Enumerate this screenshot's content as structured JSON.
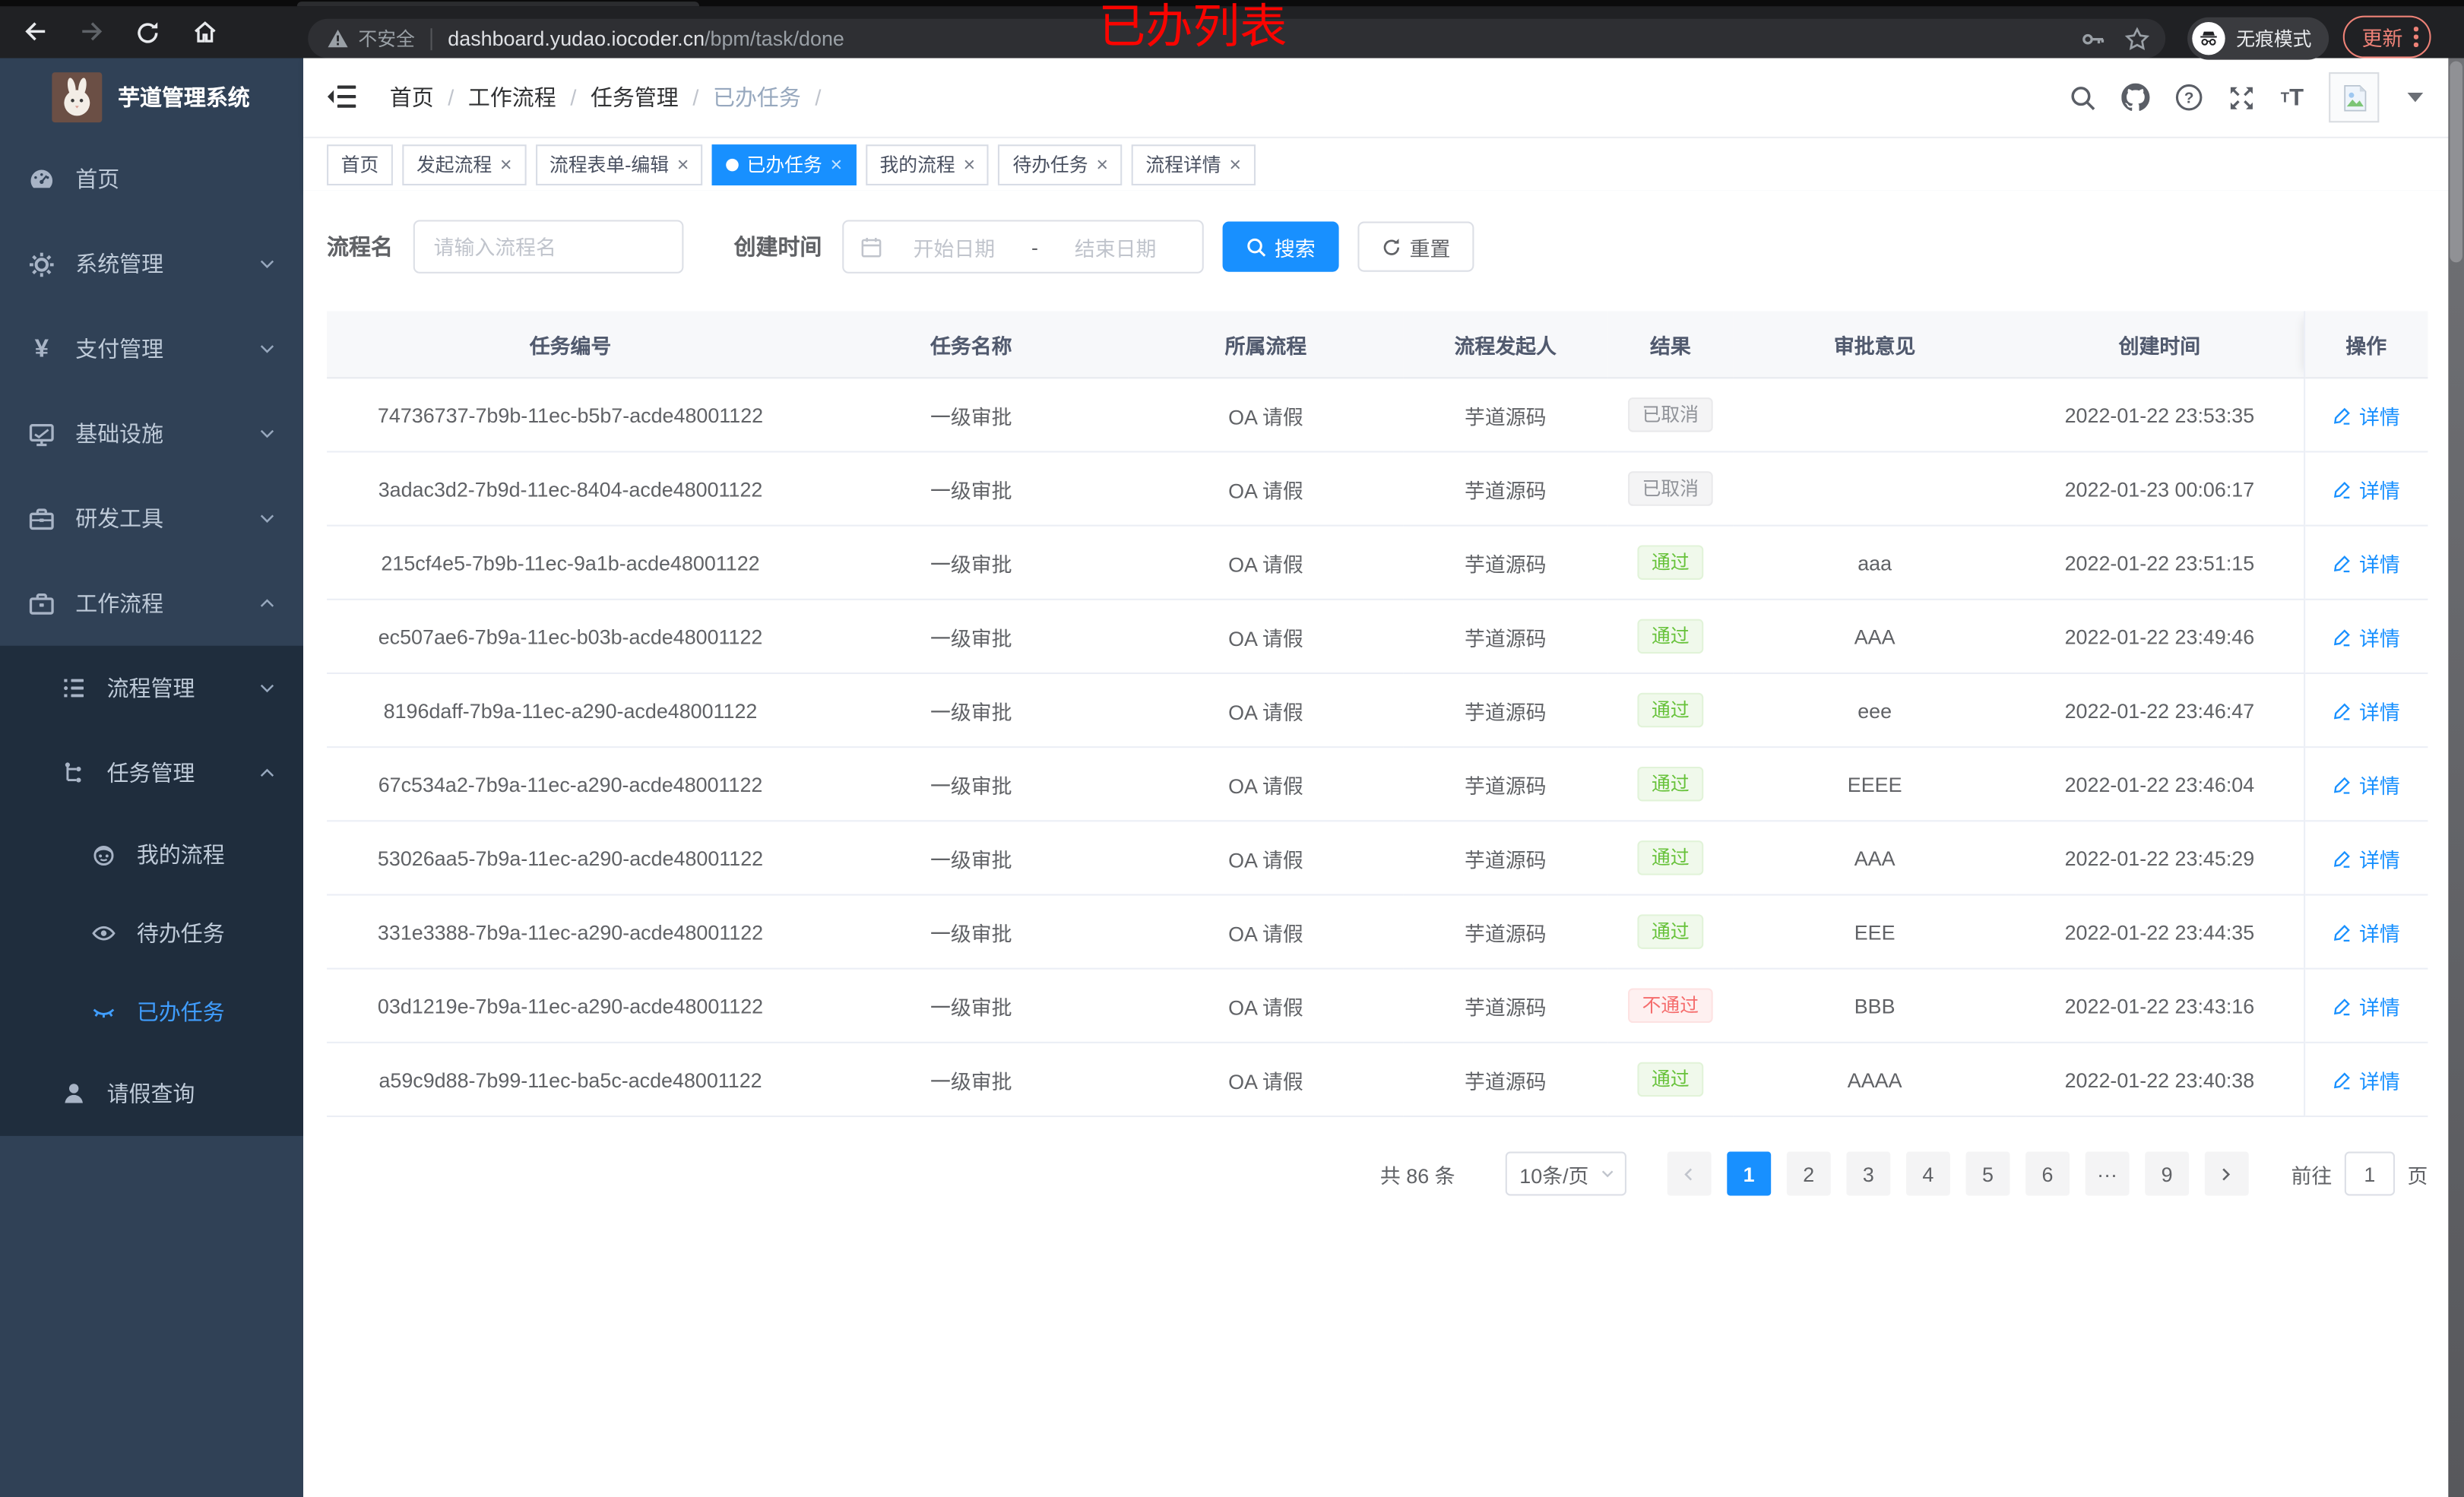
{
  "annotation": {
    "text": "已办列表",
    "color": "#fa0400"
  },
  "browser": {
    "security_label": "不安全",
    "url_host": "dashboard.yudao.iocoder.cn",
    "url_path": "/bpm/task/done",
    "incognito_label": "无痕模式",
    "update_label": "更新",
    "nav_icons": [
      "back-icon",
      "forward-icon",
      "reload-icon",
      "home-icon"
    ],
    "omnibox_icons": [
      "warning-icon",
      "key-icon",
      "star-icon"
    ],
    "right_icons": [
      "incognito-icon",
      "more-vert-icon"
    ]
  },
  "sidebar": {
    "logo_title": "芋道管理系统",
    "items": [
      {
        "label": "首页",
        "icon": "dashboard-icon",
        "level": 1
      },
      {
        "label": "系统管理",
        "icon": "gear-icon",
        "level": 1,
        "chevron": "down"
      },
      {
        "label": "支付管理",
        "icon": "yen-icon",
        "level": 1,
        "chevron": "down"
      },
      {
        "label": "基础设施",
        "icon": "monitor-icon",
        "level": 1,
        "chevron": "down"
      },
      {
        "label": "研发工具",
        "icon": "toolbox-icon",
        "level": 1,
        "chevron": "down"
      },
      {
        "label": "工作流程",
        "icon": "briefcase-icon",
        "level": 1,
        "chevron": "up"
      },
      {
        "label": "流程管理",
        "icon": "list-tree-icon",
        "level": 2,
        "chevron": "down"
      },
      {
        "label": "任务管理",
        "icon": "org-tree-icon",
        "level": 2,
        "chevron": "up"
      },
      {
        "label": "我的流程",
        "icon": "robot-icon",
        "level": 3
      },
      {
        "label": "待办任务",
        "icon": "eye-icon",
        "level": 3
      },
      {
        "label": "已办任务",
        "icon": "eye-closed-icon",
        "level": 3,
        "active": true
      },
      {
        "label": "请假查询",
        "icon": "user-icon",
        "level": 2
      }
    ]
  },
  "header": {
    "breadcrumb": [
      {
        "label": "首页"
      },
      {
        "label": "工作流程"
      },
      {
        "label": "任务管理"
      },
      {
        "label": "已办任务",
        "current": true
      }
    ],
    "action_icons": [
      "search-icon",
      "github-icon",
      "help-icon",
      "fullscreen-icon",
      "font-size-icon",
      "avatar",
      "caret-down-icon"
    ]
  },
  "tabs": [
    {
      "label": "首页",
      "closable": false
    },
    {
      "label": "发起流程",
      "closable": true
    },
    {
      "label": "流程表单-编辑",
      "closable": true
    },
    {
      "label": "已办任务",
      "closable": true,
      "active": true
    },
    {
      "label": "我的流程",
      "closable": true
    },
    {
      "label": "待办任务",
      "closable": true
    },
    {
      "label": "流程详情",
      "closable": true
    }
  ],
  "filters": {
    "name_label": "流程名",
    "name_placeholder": "请输入流程名",
    "time_label": "创建时间",
    "start_placeholder": "开始日期",
    "range_separator": "-",
    "end_placeholder": "结束日期",
    "search_label": "搜索",
    "reset_label": "重置"
  },
  "table": {
    "columns": [
      "任务编号",
      "任务名称",
      "所属流程",
      "流程发起人",
      "结果",
      "审批意见",
      "创建时间",
      "操作"
    ],
    "action_label": "详情",
    "rows": [
      {
        "id": "74736737-7b9b-11ec-b5b7-acde48001122",
        "name": "一级审批",
        "process": "OA 请假",
        "starter": "芋道源码",
        "result": "已取消",
        "result_type": "info",
        "comment": "",
        "time": "2022-01-22 23:53:35"
      },
      {
        "id": "3adac3d2-7b9d-11ec-8404-acde48001122",
        "name": "一级审批",
        "process": "OA 请假",
        "starter": "芋道源码",
        "result": "已取消",
        "result_type": "info",
        "comment": "",
        "time": "2022-01-23 00:06:17"
      },
      {
        "id": "215cf4e5-7b9b-11ec-9a1b-acde48001122",
        "name": "一级审批",
        "process": "OA 请假",
        "starter": "芋道源码",
        "result": "通过",
        "result_type": "success",
        "comment": "aaa",
        "time": "2022-01-22 23:51:15"
      },
      {
        "id": "ec507ae6-7b9a-11ec-b03b-acde48001122",
        "name": "一级审批",
        "process": "OA 请假",
        "starter": "芋道源码",
        "result": "通过",
        "result_type": "success",
        "comment": "AAA",
        "time": "2022-01-22 23:49:46"
      },
      {
        "id": "8196daff-7b9a-11ec-a290-acde48001122",
        "name": "一级审批",
        "process": "OA 请假",
        "starter": "芋道源码",
        "result": "通过",
        "result_type": "success",
        "comment": "eee",
        "time": "2022-01-22 23:46:47"
      },
      {
        "id": "67c534a2-7b9a-11ec-a290-acde48001122",
        "name": "一级审批",
        "process": "OA 请假",
        "starter": "芋道源码",
        "result": "通过",
        "result_type": "success",
        "comment": "EEEE",
        "time": "2022-01-22 23:46:04"
      },
      {
        "id": "53026aa5-7b9a-11ec-a290-acde48001122",
        "name": "一级审批",
        "process": "OA 请假",
        "starter": "芋道源码",
        "result": "通过",
        "result_type": "success",
        "comment": "AAA",
        "time": "2022-01-22 23:45:29"
      },
      {
        "id": "331e3388-7b9a-11ec-a290-acde48001122",
        "name": "一级审批",
        "process": "OA 请假",
        "starter": "芋道源码",
        "result": "通过",
        "result_type": "success",
        "comment": "EEE",
        "time": "2022-01-22 23:44:35"
      },
      {
        "id": "03d1219e-7b9a-11ec-a290-acde48001122",
        "name": "一级审批",
        "process": "OA 请假",
        "starter": "芋道源码",
        "result": "不通过",
        "result_type": "danger",
        "comment": "BBB",
        "time": "2022-01-22 23:43:16"
      },
      {
        "id": "a59c9d88-7b99-11ec-ba5c-acde48001122",
        "name": "一级审批",
        "process": "OA 请假",
        "starter": "芋道源码",
        "result": "通过",
        "result_type": "success",
        "comment": "AAAA",
        "time": "2022-01-22 23:40:38"
      }
    ]
  },
  "pagination": {
    "total_label": "共 86 条",
    "page_size": "10条/页",
    "pages": [
      {
        "label": "1",
        "active": true
      },
      {
        "label": "2"
      },
      {
        "label": "3"
      },
      {
        "label": "4"
      },
      {
        "label": "5"
      },
      {
        "label": "6"
      },
      {
        "label": "···",
        "ellipsis": true
      },
      {
        "label": "9"
      }
    ],
    "jump_label": "前往",
    "jump_value": "1",
    "jump_suffix": "页"
  },
  "colors": {
    "accent": "#1890ff",
    "sidebar_bg": "#304156",
    "submenu_bg": "#1f2d3d",
    "active_menu": "#409eff",
    "success": "#67c23a",
    "danger": "#f56c6c",
    "info": "#909399",
    "annotation_red": "#fa0400",
    "chrome_bg": "#202124",
    "update_coral": "#ee8277"
  }
}
